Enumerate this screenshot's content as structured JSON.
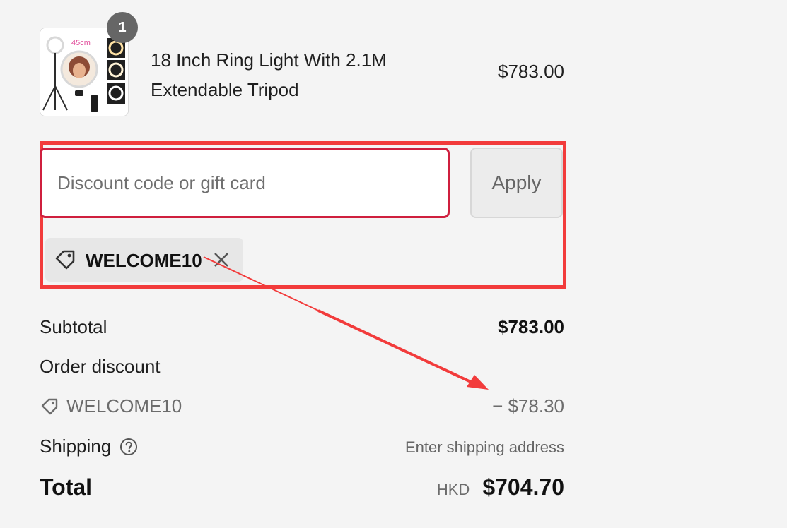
{
  "product": {
    "quantity": "1",
    "name_line1": "18 Inch Ring Light With 2.1M",
    "name_line2": "Extendable Tripod",
    "price": "$783.00",
    "thumbnail_text": "45cm"
  },
  "discount": {
    "placeholder": "Discount code or gift card",
    "value": "",
    "apply_label": "Apply",
    "applied_code": "WELCOME10"
  },
  "summary": {
    "subtotal_label": "Subtotal",
    "subtotal_value": "$783.00",
    "order_discount_label": "Order discount",
    "discount_code": "WELCOME10",
    "discount_amount": "− $78.30",
    "shipping_label": "Shipping",
    "shipping_value": "Enter shipping address",
    "total_label": "Total",
    "currency": "HKD",
    "total_value": "$704.70"
  },
  "colors": {
    "highlight": "#f23b3b",
    "input_border": "#cf1f3e",
    "background": "#f4f4f4"
  },
  "icons": {
    "tag": "tag-icon",
    "close": "close-icon",
    "help": "question-circle-icon",
    "annotation": "red-arrow"
  }
}
